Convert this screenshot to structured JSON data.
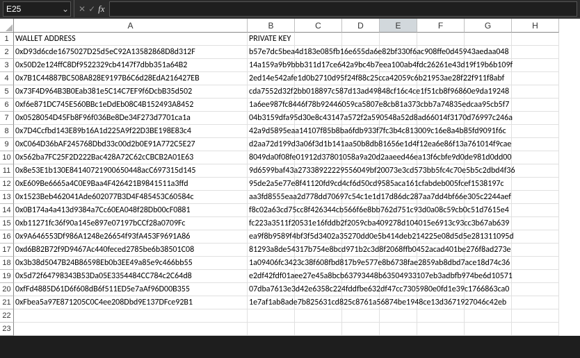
{
  "name_box": {
    "value": "E25"
  },
  "formula_bar": {
    "value": ""
  },
  "colors": {
    "selection": "#31752f"
  },
  "columns": [
    "A",
    "B",
    "C",
    "D",
    "E",
    "F",
    "G",
    "H"
  ],
  "row_count": 23,
  "selected_cell": {
    "col": "E",
    "row": 25
  },
  "selected_column_label": "E",
  "headers": {
    "col_a": "WALLET ADDRESS",
    "col_b": "PRIVATE KEY"
  },
  "rows": [
    {
      "wallet": "0xD93d6cde1675027D25d5eC92A13582868D8d312F",
      "key": "b57e7dc5bea4d183e085fb16e655da6e82bf330f6ac908ffe0d45943aedaa048"
    },
    {
      "wallet": "0x50D2e124ffC8Df9522329cb4147f7dbb351a64B2",
      "key": "14a159a9b9bbb311d17ce642a9bc4b7eea100ab4fdc26261e43d19f19b6b109f"
    },
    {
      "wallet": "0x7B1C44887BC508A828E9197B6C6d28EdA216427EB",
      "key": "2ed14e542afe1d0b2710d95f24f88c25cca42059c6b21953ae28f22f911f8abf"
    },
    {
      "wallet": "0x73F4D964B3B0Eab381e5C14C7EF9f6DcbB35d502",
      "key": "cda7552d32f2bb018897c587d13ad49848cf16c4ce1f51cb8f96860e9da19248"
    },
    {
      "wallet": "0xf6e871DC745E560BBc1eDdEb08C4B152493A8452",
      "key": "1a6ee987fc8446f78b92446059ca5807e8cb81a373cbb7a74835edcaa95cb5f7"
    },
    {
      "wallet": "0x0528054D45Fb8F96f036Be8De34F273d7701ca1a",
      "key": "04b3159dfa95d30e8c43147a572f2a590548a52d8ad66014f3170d76997c246a"
    },
    {
      "wallet": "0x7D4Ccfbd143E89b16A1d225A9f22D3BE198E83c4",
      "key": "42a9d5895eaa14107f85b8ba6fdb933f7fc3b4c813009c16e8a4b85fd9091f6c"
    },
    {
      "wallet": "0xC064D36bAF245768Dbd33c00d2b0E91A772C5E27",
      "key": "d2aa72d199d3a06f3d1b141aa50b8db81656e1d4f12ea6e86f13a761014f9cae"
    },
    {
      "wallet": "0x562ba7FC25F2D222Bac428A72C62cCBCB2A01E63",
      "key": "8049da0f08fe01912d37801058a9a20d2aaeed46ea13f6cbfe9d0de981d0dd00"
    },
    {
      "wallet": "0x8e53E1b130E84140721900650448acC697315d145",
      "key": "9d6599baf43a27338922229556049bf20073e3cd573bb5fc4c70e5b5c2dbd4f36"
    },
    {
      "wallet": "0xE609Be6665a4C0E9Baa4F426421B9841511a3ffd",
      "key": "95de2a5e77e8f41120fd9cd4cf6d50cd9585aca161cfabdeb005fcef1538197c"
    },
    {
      "wallet": "0x1523Beb462041Ade602077B3D4F485453C60584c",
      "key": "aa3fd8555eaa2d778dd70697c54c1e1d17d86dc287aa7dd4bf66e305c2244aef"
    },
    {
      "wallet": "0x0B174a4a413d9384a7Cc60EA048f28Db00cF0881",
      "key": "f8c02a63cd75cc8f426344cb566f6e8bb762d751c93d0a08c59cb0c51d7615e4"
    },
    {
      "wallet": "0xb11271fc36f90a145e897e07197bCCf28a0709Fc",
      "key": "fc223a3511f20531e16fddb2f2059cba409278d104015e6913c93cc3b67ab639"
    },
    {
      "wallet": "0x9A646553Df986A1248e26654f93fA453F9691A86",
      "key": "ea9f8b9589f4bf3f5d3402a35270dd0e5b414deb214225e08d5d5e281311095d"
    },
    {
      "wallet": "0xd6B82B72f9D9467Ac440feced2785be6b38501C08",
      "key": "81293a8de54317b754e8bcd971b2c3d8f2068ffb0452acad401be276f8ad273e"
    },
    {
      "wallet": "0x3b38d5047B24B86598Eb0b3EE49a85e9c466bb55",
      "key": "1a09406fc3423c38f608fbd817b9e577e8b6738fae2859ab8dbd7ace18d74c36"
    },
    {
      "wallet": "0x5d72f64798343B53Da05E3354484CC784c2C64d8",
      "key": "e2df42fdf01aee27e45a8bcb63793448b63504933107eb3adbfb974be6d10571"
    },
    {
      "wallet": "0xfFd4885D61D6f608dB6f511ED5e7aAf96D00B355",
      "key": "07dba7613e3d42e6358c224fddfbe632df47cc7305980e0fd1e39c1766863ca0"
    },
    {
      "wallet": "0xFbea5a97E871205C0C4ee208Dbd9E137DFce92B1",
      "key": "1e7af1ab8ade7b825631cd825c8761a56874be1948ce13d3671927046c42eb"
    }
  ]
}
